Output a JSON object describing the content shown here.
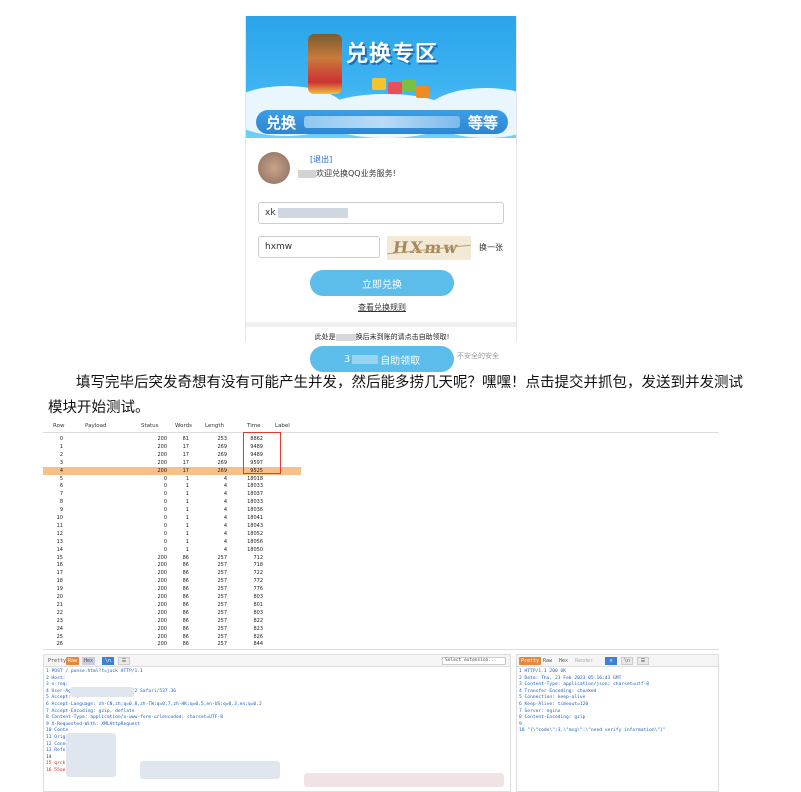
{
  "phone": {
    "banner_title": "兑换专区",
    "ribbon_left": "兑换",
    "ribbon_right": "等等",
    "logout": "[退出]",
    "welcome": "欢迎兑换QQ业务服务!",
    "account_value": "xk",
    "captcha_value": "hxmw",
    "captcha_text": "HXmw",
    "refresh": "换一张",
    "redeem_button": "立即兑换",
    "rules_link": "查看兑换规则",
    "bottom_note_pre": "此处是",
    "bottom_note_post": "换后未到账的请点击自助领取!"
  },
  "claim_button_pre": "3",
  "claim_button_post": "自助领取",
  "watermark": "不安全的安全",
  "paragraph": "填写完毕后突发奇想有没有可能产生并发，然后能多捞几天呢？嘿嘿！点击提交并抓包，发送到并发测试模块开始测试。",
  "intruder": {
    "columns": [
      "Row",
      "Payload",
      "Status",
      "Words",
      "Length",
      "Time",
      "Label"
    ],
    "rows": [
      [
        "0",
        "",
        "200",
        "81",
        "253",
        "8862"
      ],
      [
        "1",
        "",
        "200",
        "17",
        "269",
        "9489"
      ],
      [
        "2",
        "",
        "200",
        "17",
        "269",
        "9489"
      ],
      [
        "3",
        "",
        "200",
        "17",
        "269",
        "9597"
      ],
      [
        "4",
        "",
        "200",
        "17",
        "269",
        "9525"
      ],
      [
        "5",
        "",
        "0",
        "1",
        "4",
        "18018"
      ],
      [
        "6",
        "",
        "0",
        "1",
        "4",
        "18033"
      ],
      [
        "7",
        "",
        "0",
        "1",
        "4",
        "18037"
      ],
      [
        "8",
        "",
        "0",
        "1",
        "4",
        "18033"
      ],
      [
        "9",
        "",
        "0",
        "1",
        "4",
        "18036"
      ],
      [
        "10",
        "",
        "0",
        "1",
        "4",
        "18041"
      ],
      [
        "11",
        "",
        "0",
        "1",
        "4",
        "18043"
      ],
      [
        "12",
        "",
        "0",
        "1",
        "4",
        "18052"
      ],
      [
        "13",
        "",
        "0",
        "1",
        "4",
        "18056"
      ],
      [
        "14",
        "",
        "0",
        "1",
        "4",
        "18050"
      ],
      [
        "15",
        "",
        "200",
        "86",
        "257",
        "712"
      ],
      [
        "16",
        "",
        "200",
        "86",
        "257",
        "718"
      ],
      [
        "17",
        "",
        "200",
        "86",
        "257",
        "722"
      ],
      [
        "18",
        "",
        "200",
        "86",
        "257",
        "772"
      ],
      [
        "19",
        "",
        "200",
        "86",
        "257",
        "776"
      ],
      [
        "20",
        "",
        "200",
        "86",
        "257",
        "803"
      ],
      [
        "21",
        "",
        "200",
        "86",
        "257",
        "801"
      ],
      [
        "22",
        "",
        "200",
        "86",
        "257",
        "803"
      ],
      [
        "23",
        "",
        "200",
        "86",
        "257",
        "822"
      ],
      [
        "24",
        "",
        "200",
        "86",
        "257",
        "823"
      ],
      [
        "25",
        "",
        "200",
        "86",
        "257",
        "826"
      ],
      [
        "26",
        "",
        "200",
        "86",
        "257",
        "844"
      ]
    ]
  },
  "request_pane": {
    "tabs": [
      "Pretty",
      "Raw",
      "Hex",
      "\\n",
      "☰"
    ],
    "extension_select": "Select extension...",
    "lines": [
      "1  POST /        ponse.html?t=juck HTTP/1.1",
      "2  Host:",
      "3  x-req:",
      "4  User-Agent:              Chrome/32.0.1700.72 Safari/537.36",
      "5  Accept: */*",
      "6  Accept-Language: zh-CN,zh;q=0.8,zh-TW;q=0.7,zh-HK;q=0.5,en-US;q=0.3,en;q=0.2",
      "7  Accept-Encoding: gzip, deflate",
      "8  Content-Type: application/x-www-form-urlencoded; charset=UTF-8",
      "9  X-Requested-With: XMLHttpRequest",
      "10 Conte",
      "11 Origi",
      "12 Conne",
      "13 Refere",
      "14",
      "15 qrckrtym3dN2PW.Sr",
      "16 55ae3db4d8"
    ]
  },
  "response_pane": {
    "tabs": [
      "Pretty",
      "Raw",
      "Hex",
      "Render",
      "≡",
      "\\n",
      "☰"
    ],
    "lines": [
      "1  HTTP/1.1 200 OK",
      "2  Date: Thu, 23 Feb 2023 05:16:43 GMT",
      "3  Content-Type: application/json; charset=utf-8",
      "4  Transfer-Encoding: chunked",
      "5  Connection: keep-alive",
      "6  Keep-Alive: timeout=120",
      "7  Server: nginx",
      "8  Content-Encoding: gzip",
      "9",
      "10 \"{\\\"code\\\":3,\\\"msg\\\":\\\"need verify information\\\"}\""
    ]
  }
}
